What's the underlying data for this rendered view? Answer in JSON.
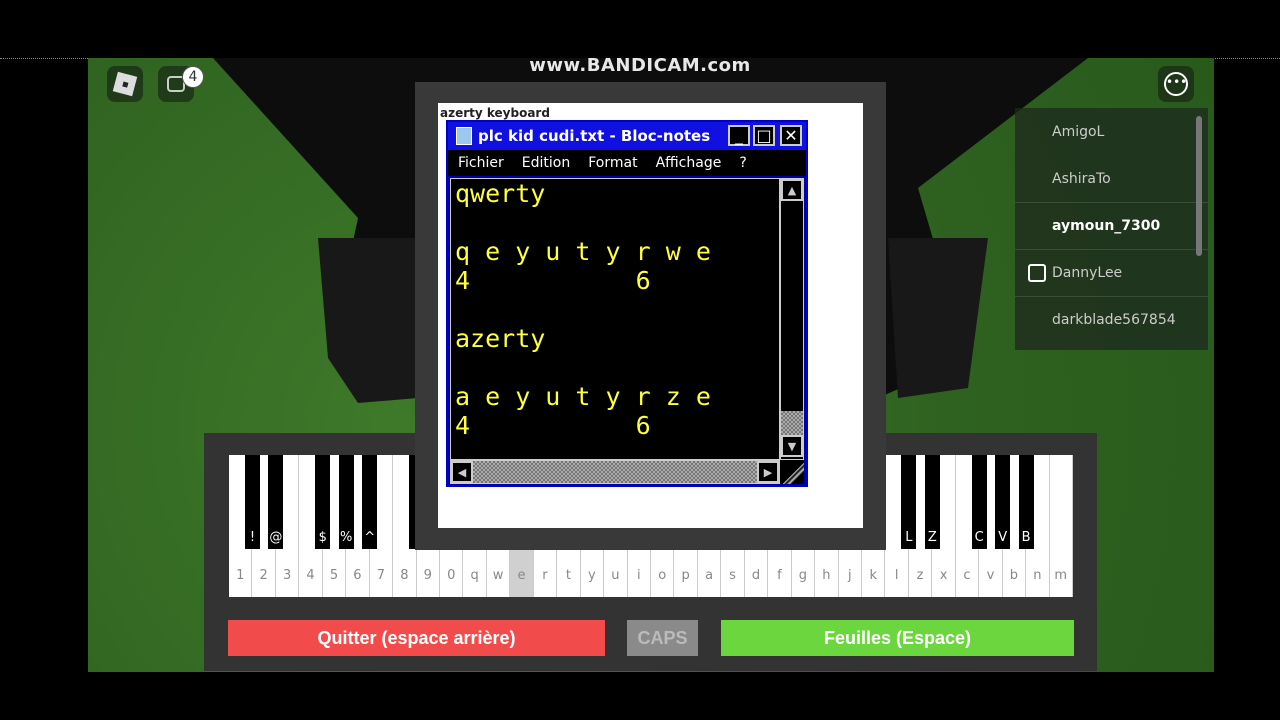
{
  "recorder": {
    "watermark": "www.BANDICAM.com"
  },
  "hud": {
    "roblox_menu_icon": "roblox-logo-icon",
    "chat_icon": "chat-icon",
    "chat_unread_count": "4",
    "more_icon": "ellipsis-icon"
  },
  "players": [
    {
      "name": "AmigoL"
    },
    {
      "name": "AshiraTo"
    },
    {
      "name": "aymoun_7300",
      "current_user": true
    },
    {
      "name": "DannyLee",
      "badge_icon": "premium-icon"
    },
    {
      "name": "darkblade567854"
    }
  ],
  "sheet": {
    "title": "azerty keyboard"
  },
  "notepad": {
    "title": "plc kid cudi.txt - Bloc-notes",
    "menu": [
      "Fichier",
      "Edition",
      "Format",
      "Affichage",
      "?"
    ],
    "content": "qwerty\n\nq e y u t y r w e\n4           6\n\nazerty\n\na e y u t y r z e\n4           6"
  },
  "piano": {
    "white_keys": [
      "1",
      "2",
      "3",
      "4",
      "5",
      "6",
      "7",
      "8",
      "9",
      "0",
      "q",
      "w",
      "e",
      "r",
      "t",
      "y",
      "u",
      "i",
      "o",
      "p",
      "a",
      "s",
      "d",
      "f",
      "g",
      "h",
      "j",
      "k",
      "l",
      "z",
      "x",
      "c",
      "v",
      "b",
      "n",
      "m"
    ],
    "highlighted_key": "e",
    "black_keys_visible_left": [
      "!",
      "@",
      "$",
      "%",
      "^"
    ],
    "black_keys_visible_right": [
      "L",
      "Z",
      "C",
      "V",
      "B"
    ]
  },
  "buttons": {
    "quit": "Quitter (espace arrière)",
    "caps": "CAPS",
    "sheets": "Feuilles (Espace)"
  },
  "colors": {
    "quit": "#f24b4b",
    "caps": "#8a8a8a",
    "sheets": "#6cd63f",
    "notepad_text": "#ffff40"
  }
}
